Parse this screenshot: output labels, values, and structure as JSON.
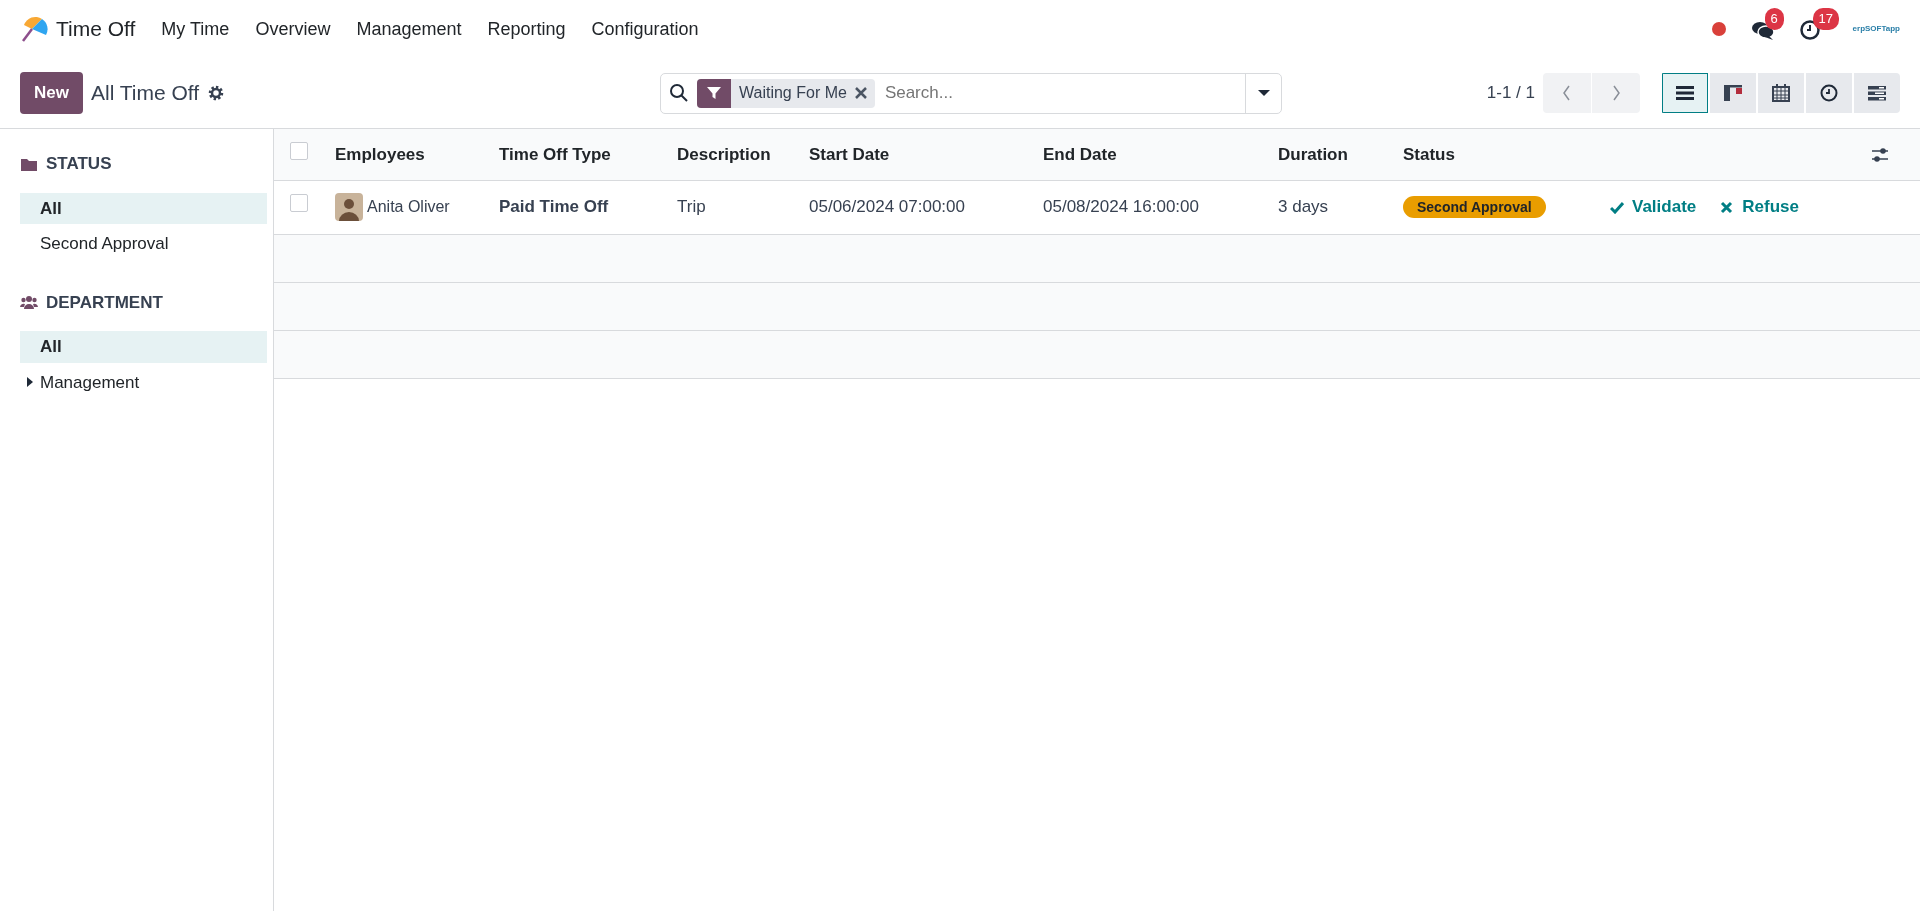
{
  "app": {
    "name": "Time Off"
  },
  "menu": [
    "My Time",
    "Overview",
    "Management",
    "Reporting",
    "Configuration"
  ],
  "systray": {
    "chat_count": "6",
    "activity_count": "17",
    "logo_text": "erpSOFTapp"
  },
  "control": {
    "new_button": "New",
    "title": "All Time Off",
    "search": {
      "facet": "Waiting For Me",
      "placeholder": "Search..."
    },
    "pager": "1-1 / 1",
    "views": [
      {
        "kind": "list",
        "selected": true
      },
      {
        "kind": "kanban",
        "selected": false
      },
      {
        "kind": "calendar",
        "selected": false
      },
      {
        "kind": "activity",
        "selected": false
      },
      {
        "kind": "gantt",
        "selected": false
      }
    ]
  },
  "sidebar": [
    {
      "kind": "folder",
      "title": "STATUS",
      "items": [
        {
          "label": "All",
          "selected": true,
          "expandable": false
        },
        {
          "label": "Second Approval",
          "selected": false,
          "expandable": false
        }
      ]
    },
    {
      "kind": "people",
      "title": "DEPARTMENT",
      "items": [
        {
          "label": "All",
          "selected": true,
          "expandable": false
        },
        {
          "label": "Management",
          "selected": false,
          "expandable": true
        }
      ]
    }
  ],
  "table": {
    "all_checked": false,
    "columns": [
      "Employees",
      "Time Off Type",
      "Description",
      "Start Date",
      "End Date",
      "Duration",
      "Status"
    ],
    "rows": [
      {
        "checked": false,
        "employee": "Anita Oliver",
        "type": "Paid Time Off",
        "description": "Trip",
        "start": "05/06/2024 07:00:00",
        "end": "05/08/2024 16:00:00",
        "duration": "3 days",
        "status": "Second Approval",
        "actions": [
          {
            "kind": "validate",
            "label": "Validate"
          },
          {
            "kind": "refuse",
            "label": "Refuse"
          }
        ]
      }
    ]
  }
}
